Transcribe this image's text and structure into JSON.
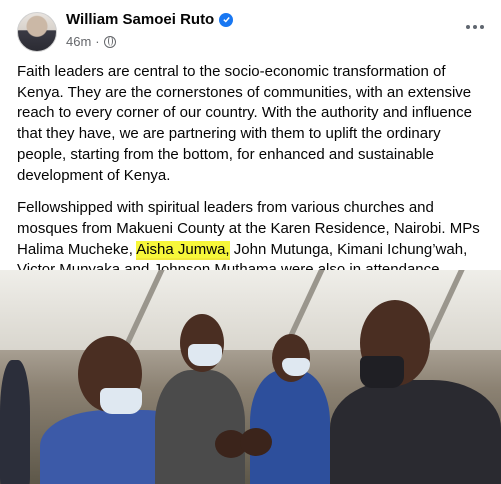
{
  "post": {
    "author": "William Samoei Ruto",
    "time": "46m",
    "separator": "·",
    "paragraphs": [
      "Faith leaders are central to the socio-economic transformation of Kenya. They are the cornerstones of communities, with an extensive reach to every corner of our country. With the authority and influence that they have, we are partnering with them to uplift the ordinary people, starting from the bottom, for enhanced and sustainable development of Kenya."
    ],
    "para2_before": "Fellowshipped with spiritual leaders from various churches and mosques from Makueni County at the Karen Residence, Nairobi. MPs Halima Mucheke, ",
    "para2_highlight": "Aisha Jumwa,",
    "para2_after": " John Mutunga, Kimani Ichung’wah, Victor Munyaka and Johnson Muthama were also in attendance."
  },
  "icons": {
    "verified": "verified-badge-icon",
    "audience": "globe-icon",
    "more": "more-options-icon"
  },
  "colors": {
    "verified_blue": "#1877f2",
    "secondary_text": "#65676b",
    "highlight": "#f7f73a"
  }
}
